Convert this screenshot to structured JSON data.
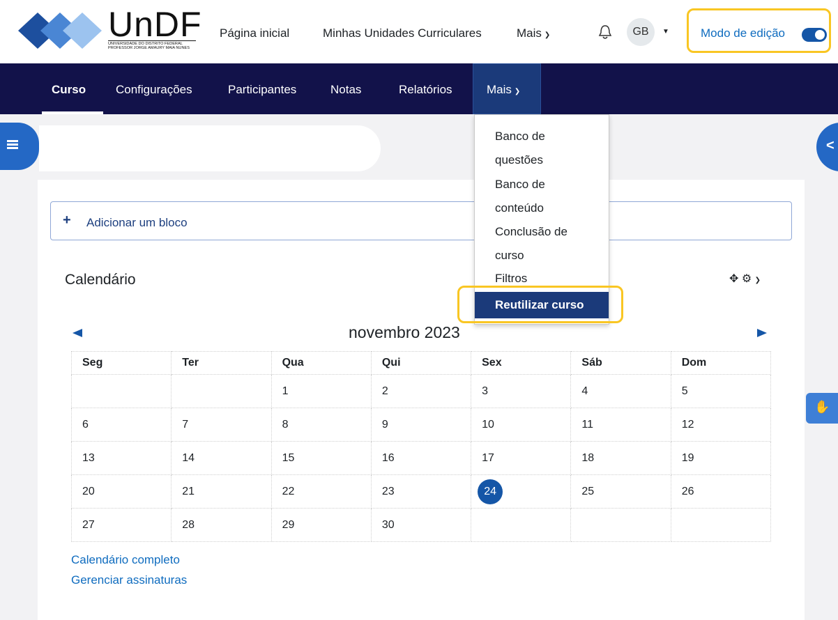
{
  "header": {
    "logo": {
      "big": "UnDF",
      "line1": "UNIVERSIDADE DO DISTRITO FEDERAL",
      "line2": "PROFESSOR JORGE AMAURY MAIA NUNES"
    },
    "nav": [
      "Página inicial",
      "Minhas Unidades Curriculares",
      "Mais"
    ],
    "avatar": "GB",
    "edit_mode_label": "Modo de edição",
    "edit_mode_on": true
  },
  "secnav": {
    "items": [
      "Curso",
      "Configurações",
      "Participantes",
      "Notas",
      "Relatórios"
    ],
    "more": "Mais",
    "active": "Curso"
  },
  "dropdown": {
    "items": [
      "Banco de questões",
      "Banco de conteúdo",
      "Conclusão de curso",
      "Filtros"
    ],
    "active": "Reutilizar curso"
  },
  "add_block": {
    "label": "Adicionar um bloco"
  },
  "calendar": {
    "title": "Calendário",
    "month": "novembro 2023",
    "weekdays": [
      "Seg",
      "Ter",
      "Qua",
      "Qui",
      "Sex",
      "Sáb",
      "Dom"
    ],
    "weeks": [
      [
        "",
        "",
        "1",
        "2",
        "3",
        "4",
        "5"
      ],
      [
        "6",
        "7",
        "8",
        "9",
        "10",
        "11",
        "12"
      ],
      [
        "13",
        "14",
        "15",
        "16",
        "17",
        "18",
        "19"
      ],
      [
        "20",
        "21",
        "22",
        "23",
        "24",
        "25",
        "26"
      ],
      [
        "27",
        "28",
        "29",
        "30",
        "",
        "",
        ""
      ]
    ],
    "today": "24",
    "links": [
      "Calendário completo",
      "Gerenciar assinaturas"
    ]
  },
  "colors": {
    "primary": "#1556a7",
    "navbar": "#12124a",
    "highlight": "#f9c623",
    "link": "#0f6cbf"
  }
}
